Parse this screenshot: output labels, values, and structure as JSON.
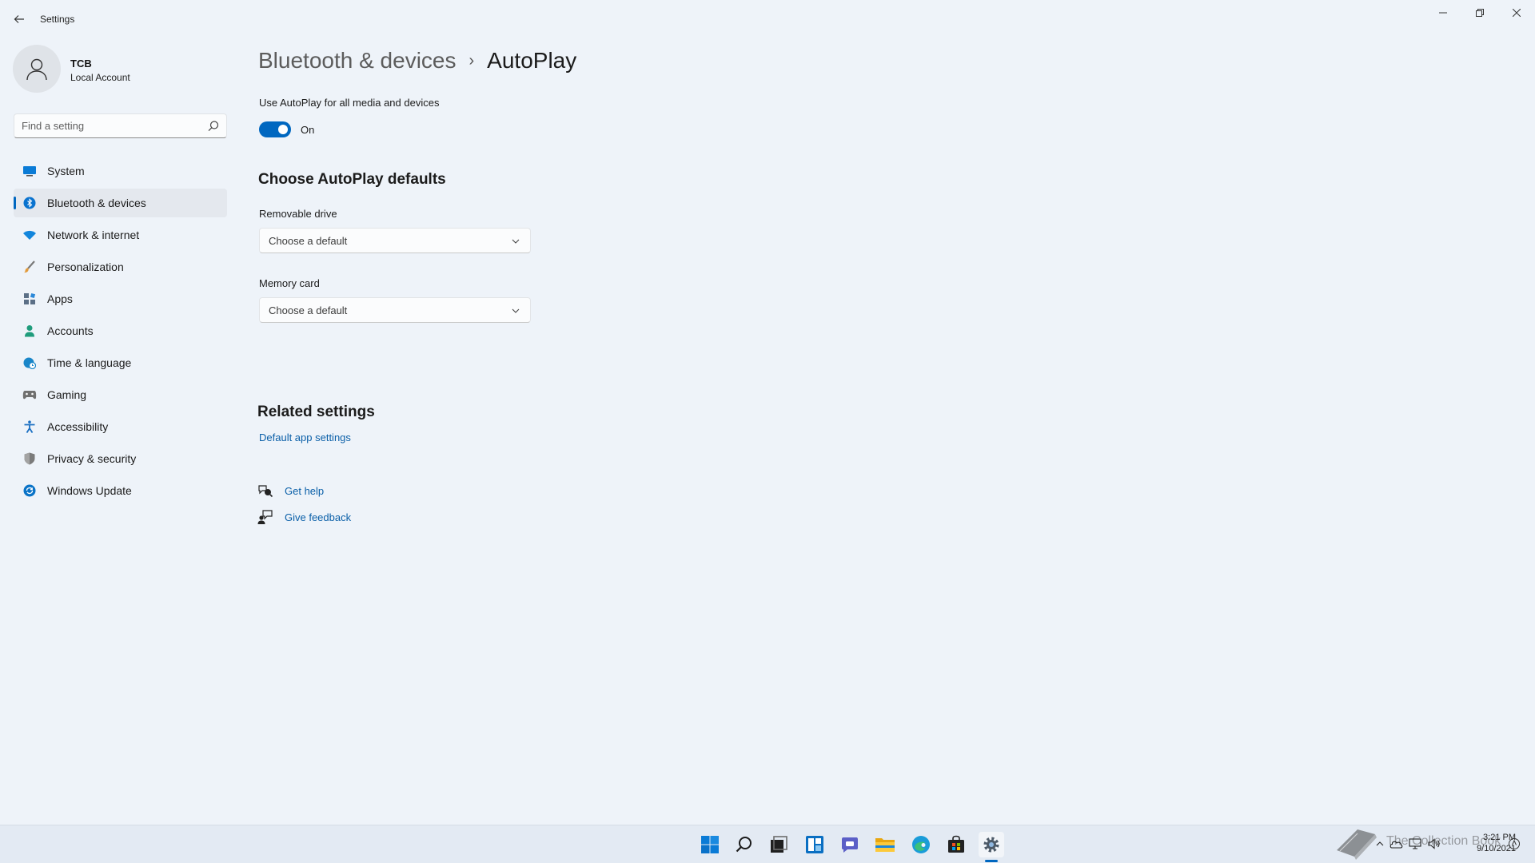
{
  "window": {
    "app_title": "Settings",
    "back_icon": "back-arrow-icon",
    "controls": [
      "minimize-icon",
      "maximize-icon",
      "close-icon"
    ]
  },
  "profile": {
    "name": "TCB",
    "account_type": "Local Account",
    "avatar_icon": "person-icon"
  },
  "search": {
    "placeholder": "Find a setting",
    "icon": "search-icon"
  },
  "sidebar": {
    "items": [
      {
        "label": "System",
        "icon": "system-monitor-icon",
        "color": "#0078d4"
      },
      {
        "label": "Bluetooth & devices",
        "icon": "bluetooth-icon",
        "color": "#0067c0"
      },
      {
        "label": "Network & internet",
        "icon": "wifi-icon",
        "color": "#0078d4"
      },
      {
        "label": "Personalization",
        "icon": "paintbrush-icon",
        "color": "#d08b3b"
      },
      {
        "label": "Apps",
        "icon": "apps-icon",
        "color": "#5a6d85"
      },
      {
        "label": "Accounts",
        "icon": "person-icon",
        "color": "#1f9c7c"
      },
      {
        "label": "Time & language",
        "icon": "globe-clock-icon",
        "color": "#1a86c9"
      },
      {
        "label": "Gaming",
        "icon": "gamepad-icon",
        "color": "#6b6b6b"
      },
      {
        "label": "Accessibility",
        "icon": "accessibility-icon",
        "color": "#1a6fc2"
      },
      {
        "label": "Privacy & security",
        "icon": "shield-icon",
        "color": "#7b7b7b"
      },
      {
        "label": "Windows Update",
        "icon": "update-icon",
        "color": "#0a73c7"
      }
    ],
    "active_index": 1
  },
  "breadcrumb": {
    "parent": "Bluetooth & devices",
    "separator": "›",
    "current": "AutoPlay"
  },
  "autoplay": {
    "label": "Use AutoPlay for all media and devices",
    "toggle_on": true,
    "state_text": "On"
  },
  "defaults": {
    "title": "Choose AutoPlay defaults",
    "removable_drive": {
      "label": "Removable drive",
      "value": "Choose a default"
    },
    "memory_card": {
      "label": "Memory card",
      "value": "Choose a default"
    }
  },
  "related": {
    "title": "Related settings",
    "default_apps_link": "Default app settings"
  },
  "help": {
    "get_help": "Get help",
    "give_feedback": "Give feedback"
  },
  "taskbar": {
    "icons": [
      "windows-start-icon",
      "search-icon",
      "task-view-icon",
      "widgets-icon",
      "teams-chat-icon",
      "file-explorer-icon",
      "edge-browser-icon",
      "store-icon",
      "settings-icon"
    ],
    "accent": "#0067c0",
    "tray_icons": [
      "chevron-up-icon",
      "onedrive-cloud-icon",
      "network-icon",
      "volume-icon"
    ],
    "time": "3:21 PM",
    "date": "9/10/2021"
  },
  "watermark": {
    "text": "The Collection Book"
  }
}
